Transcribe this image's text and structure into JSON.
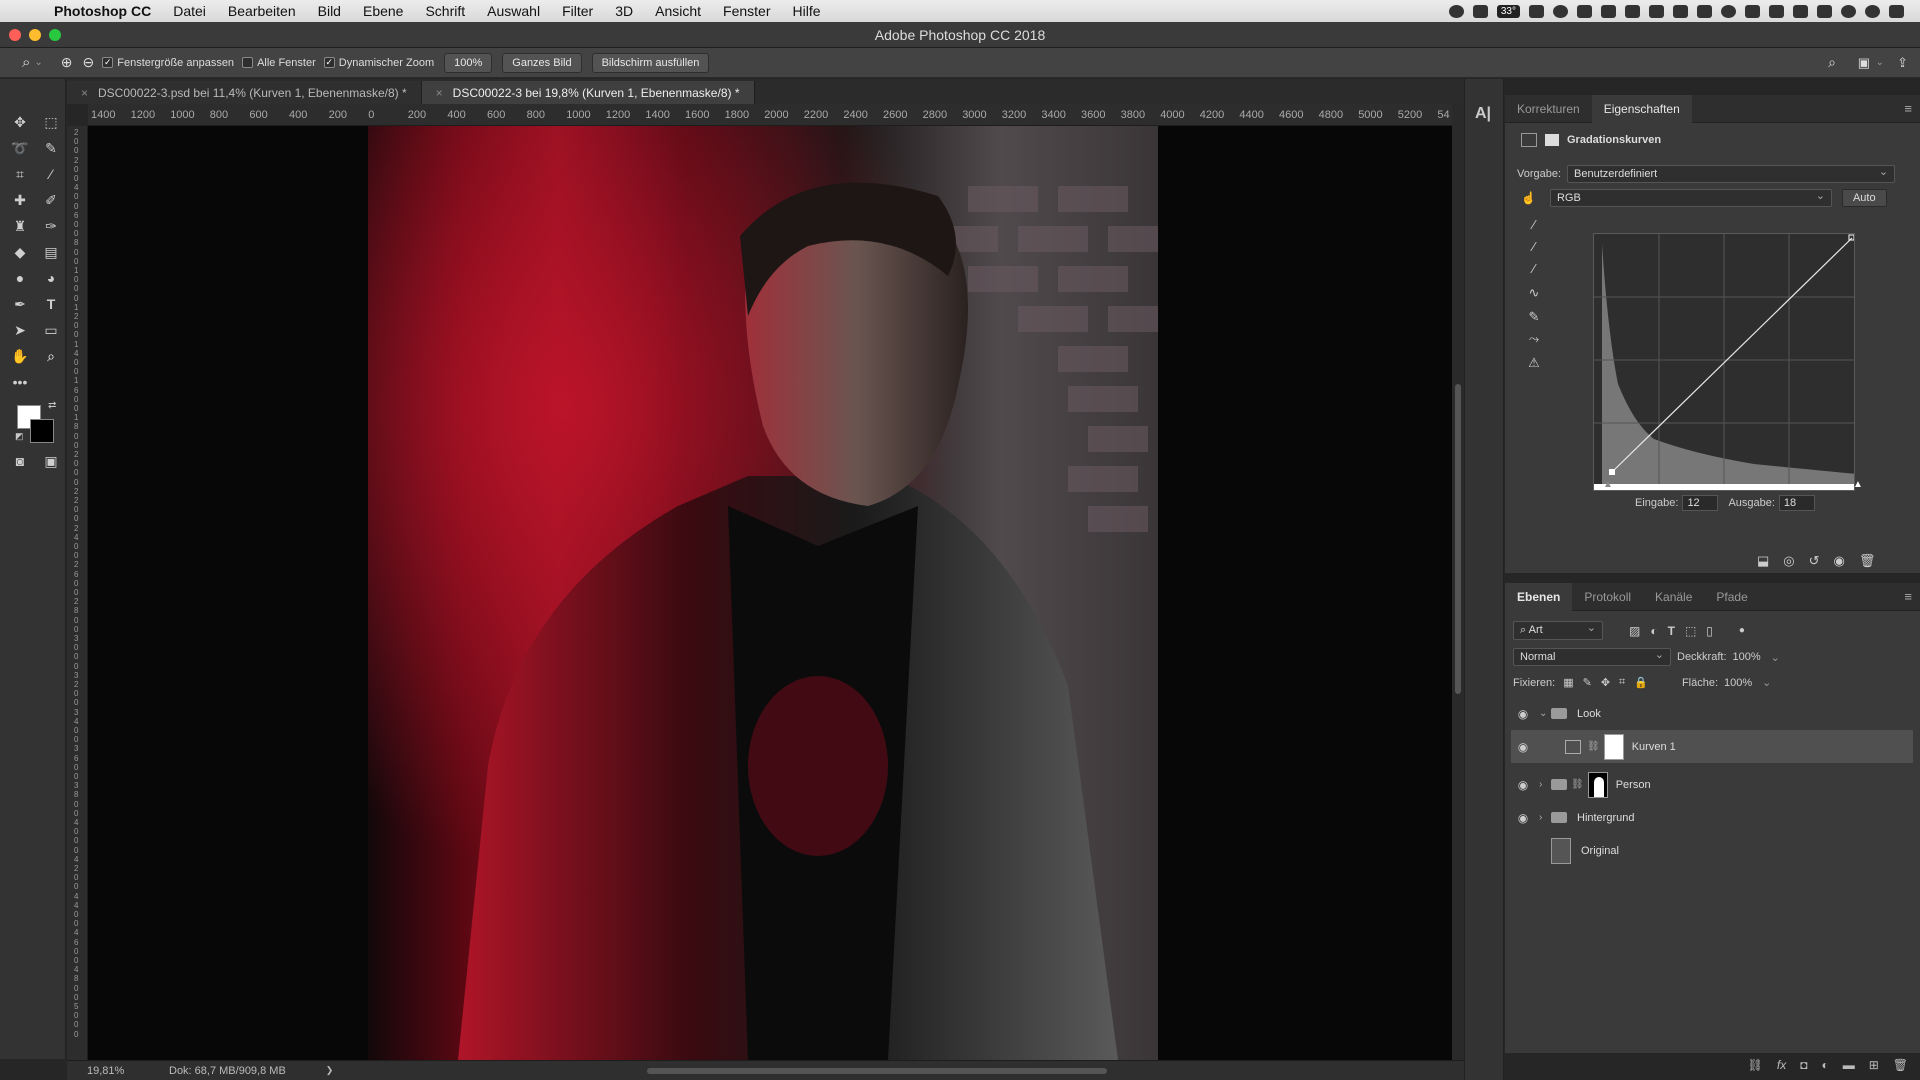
{
  "menubar": {
    "items": [
      "Photoshop CC",
      "Datei",
      "Bearbeiten",
      "Bild",
      "Ebene",
      "Schrift",
      "Auswahl",
      "Filter",
      "3D",
      "Ansicht",
      "Fenster",
      "Hilfe"
    ],
    "battery_badge": "33°"
  },
  "window": {
    "title": "Adobe Photoshop CC 2018"
  },
  "options": {
    "fit_window_label": "Fenstergröße anpassen",
    "all_windows_label": "Alle Fenster",
    "dynamic_zoom_label": "Dynamischer Zoom",
    "zoom_value": "100%",
    "fit_screen_label": "Ganzes Bild",
    "fill_screen_label": "Bildschirm ausfüllen"
  },
  "tabs": [
    {
      "label": "DSC00022-3.psd bei 11,4% (Kurven 1, Ebenenmaske/8) *"
    },
    {
      "label": "DSC00022-3 bei 19,8% (Kurven 1, Ebenenmaske/8) *"
    }
  ],
  "ruler": {
    "h_ticks": [
      "1400",
      "1200",
      "1000",
      "800",
      "600",
      "400",
      "200",
      "0",
      "200",
      "400",
      "600",
      "800",
      "1000",
      "1200",
      "1400",
      "1600",
      "1800",
      "2000",
      "2200",
      "2400",
      "2600",
      "2800",
      "3000",
      "3200",
      "3400",
      "3600",
      "3800",
      "4000",
      "4200",
      "4400",
      "4600",
      "4800",
      "5000",
      "5200",
      "54"
    ],
    "v_ticks": [
      "2",
      "0",
      "0",
      "2",
      "0",
      "0",
      "4",
      "0",
      "0",
      "6",
      "0",
      "0",
      "8",
      "0",
      "0",
      "1",
      "0",
      "0",
      "0",
      "1",
      "2",
      "0",
      "0",
      "1",
      "4",
      "0",
      "0",
      "1",
      "6",
      "0",
      "0",
      "1",
      "8",
      "0",
      "0",
      "2",
      "0",
      "0",
      "0",
      "2",
      "2",
      "0",
      "0",
      "2",
      "4",
      "0",
      "0",
      "2",
      "6",
      "0",
      "0",
      "2",
      "8",
      "0",
      "0",
      "3",
      "0",
      "0",
      "0",
      "3",
      "2",
      "0",
      "0",
      "3",
      "4",
      "0",
      "0",
      "3",
      "6",
      "0",
      "0",
      "3",
      "8",
      "0",
      "0",
      "4",
      "0",
      "0",
      "0",
      "4",
      "2",
      "0",
      "0",
      "4",
      "4",
      "0",
      "0",
      "4",
      "6",
      "0",
      "0",
      "4",
      "8",
      "0",
      "0",
      "5",
      "0",
      "0",
      "0"
    ]
  },
  "status": {
    "zoom": "19,81%",
    "doc": "Dok: 68,7 MB/909,8 MB",
    "chevron": "❯"
  },
  "properties": {
    "tabs": [
      "Korrekturen",
      "Eigenschaften"
    ],
    "title": "Gradationskurven",
    "preset_label": "Vorgabe:",
    "preset_value": "Benutzerdefiniert",
    "channel_value": "RGB",
    "auto_label": "Auto",
    "input_label": "Eingabe:",
    "input_value": "12",
    "output_label": "Ausgabe:",
    "output_value": "18"
  },
  "layers": {
    "tabs": [
      "Ebenen",
      "Protokoll",
      "Kanäle",
      "Pfade"
    ],
    "filter_value": "Art",
    "blend_mode": "Normal",
    "opacity_label": "Deckkraft:",
    "opacity_value": "100%",
    "lock_label": "Fixieren:",
    "fill_label": "Fläche:",
    "fill_value": "100%",
    "items": [
      {
        "name": "Look"
      },
      {
        "name": "Kurven 1"
      },
      {
        "name": "Person"
      },
      {
        "name": "Hintergrund"
      },
      {
        "name": "Original"
      }
    ]
  },
  "icons": {
    "apple": "",
    "eye": "◉",
    "chevron_right": "›",
    "chevron_down": "⌄",
    "close": "×"
  }
}
